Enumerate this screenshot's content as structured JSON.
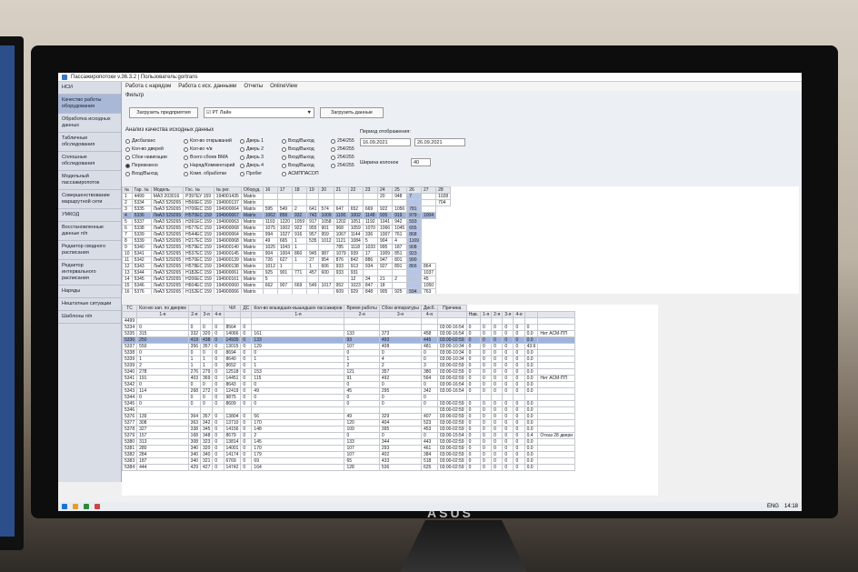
{
  "window": {
    "title": "Пассажиропотоки v.36.3.2 | Пользователь:gortrans"
  },
  "sidebar": {
    "items": [
      {
        "label": "НСИ"
      },
      {
        "label": "Качество работы оборудования"
      },
      {
        "label": "Обработка исходных данных"
      },
      {
        "label": "Табличные обследования"
      },
      {
        "label": "Сплошные обследования"
      },
      {
        "label": "Модельный пассажиропоток"
      },
      {
        "label": "Совершенствование маршрутной сети"
      },
      {
        "label": "УМКОД"
      },
      {
        "label": "Восстановленные данные п/п"
      },
      {
        "label": "Редактор сводного расписания"
      },
      {
        "label": "Редактор интервального расписания"
      },
      {
        "label": "Наряды"
      },
      {
        "label": "Нештатные ситуации"
      },
      {
        "label": "Шаблоны п/п"
      }
    ]
  },
  "menu": {
    "items": [
      "Работа с нарядом",
      "Работа с исх. данными",
      "Отчеты",
      "OnlineView"
    ]
  },
  "filter": {
    "label": "Фильтр",
    "load_enterprises": "Загрузить предприятия",
    "enterprise_value": "РТ Лайн",
    "load_data": "Загрузить данные",
    "analysis_label": "Анализ качества исходных данных",
    "radios": [
      [
        "Дисбаланс",
        "Кол-во открываний",
        "Дверь 1",
        "Вход/Выход",
        "254/255"
      ],
      [
        "Кол-во дверей",
        "Кол-во ч/в",
        "Дверь 2",
        "Вход/Выход",
        "254/255"
      ],
      [
        "Сбои навигации",
        "Всего сбоев ВМА",
        "Дверь 3",
        "Вход/Выход",
        "254/255"
      ],
      [
        "Перевезено",
        "Наряд/Комментарий",
        "Дверь 4",
        "Вход/Выход",
        "254/255"
      ],
      [
        "Вход/Выход",
        "Комп. обработки",
        "Пробег",
        "АСМППАСОП",
        ""
      ]
    ],
    "period_label": "Период отображения:",
    "date_from": "16.09.2021",
    "date_to": "26.09.2021",
    "width_label": "Ширина колонок",
    "width_value": "40"
  },
  "grid1": {
    "headers": [
      "№",
      "Гар. №",
      "Модель",
      "Гос. №",
      "№ рег.",
      "Оборуд.",
      "16",
      "17",
      "18",
      "19",
      "20",
      "21",
      "22",
      "23",
      "24",
      "25",
      "26",
      "27",
      "28"
    ],
    "rows": [
      [
        "1",
        "4499",
        "МАЗ 203016",
        "Р397ЕУ 159",
        "194001435",
        "Matrix",
        "",
        "",
        "",
        "",
        "",
        "",
        "",
        "",
        "20",
        "948",
        "7",
        "",
        "1028"
      ],
      [
        "2",
        "5334",
        "ЛиАЗ 529265",
        "Н566ЕС 159",
        "194900137",
        "Matrix",
        "",
        "",
        "",
        "",
        "",
        "",
        "",
        "",
        "",
        "",
        "",
        "",
        "704"
      ],
      [
        "3",
        "5335",
        "ЛиАЗ 529265",
        "Н706ЕС 159",
        "194900064",
        "Matrix",
        "595",
        "549",
        "2",
        "641",
        "574",
        "647",
        "652",
        "669",
        "922",
        "1056",
        "781",
        ""
      ],
      [
        "4",
        "5336",
        "ЛиАЗ 529265",
        "Н570ЕС 159",
        "194900067",
        "Matrix",
        "1062",
        "858",
        "932",
        "742",
        "1009",
        "1100",
        "1002",
        "1148",
        "935",
        "919",
        "979",
        "1004"
      ],
      [
        "5",
        "5337",
        "ЛиАЗ 529265",
        "Н391ЕС 159",
        "194900063",
        "Matrix",
        "1193",
        "1220",
        "1059",
        "917",
        "1058",
        "1202",
        "1051",
        "1192",
        "1041",
        "942",
        "593"
      ],
      [
        "6",
        "5338",
        "ЛиАЗ 529265",
        "Н577ЕС 159",
        "194900068",
        "Matrix",
        "1075",
        "1002",
        "922",
        "955",
        "901",
        "968",
        "1059",
        "1070",
        "1066",
        "1045",
        "655"
      ],
      [
        "7",
        "5339",
        "ЛиАЗ 529265",
        "Н544ЕС 159",
        "194900064",
        "Matrix",
        "994",
        "1027",
        "916",
        "957",
        "959",
        "1067",
        "1144",
        "336",
        "1007",
        "761",
        "868"
      ],
      [
        "8",
        "5339",
        "ЛиАЗ 529265",
        "Н217ЕС 159",
        "194900068",
        "Matrix",
        "49",
        "665",
        "1",
        "535",
        "1012",
        "1121",
        "1084",
        "5",
        "904",
        "4",
        "1169"
      ],
      [
        "9",
        "5340",
        "ЛиАЗ 529265",
        "Н579ЕС 159",
        "194900140",
        "Matrix",
        "1025",
        "1043",
        "1",
        "",
        "",
        "785",
        "1118",
        "1033",
        "995",
        "187",
        "908"
      ],
      [
        "10",
        "5341",
        "ЛиАЗ 529265",
        "Н537ЕС 159",
        "194900145",
        "Matrix",
        "904",
        "1004",
        "860",
        "945",
        "987",
        "1079",
        "939",
        "17",
        "1009",
        "851",
        "923"
      ],
      [
        "11",
        "5342",
        "ЛиАЗ 529265",
        "Н570ЕС 159",
        "194900139",
        "Matrix",
        "726",
        "627",
        "1",
        "27",
        "954",
        "876",
        "842",
        "886",
        "947",
        "801",
        "990"
      ],
      [
        "12",
        "5343",
        "ЛиАЗ 529265",
        "Н578ЕС 159",
        "194900138",
        "Matrix",
        "1012",
        "1",
        "",
        "1",
        "606",
        "933",
        "913",
        "934",
        "927",
        "891",
        "866",
        "864"
      ],
      [
        "13",
        "5344",
        "ЛиАЗ 529265",
        "Н182ЕС 159",
        "194900061",
        "Matrix",
        "925",
        "901",
        "771",
        "457",
        "600",
        "933",
        "931",
        "",
        "",
        "",
        "",
        "1037"
      ],
      [
        "14",
        "5345",
        "ЛиАЗ 529265",
        "Н206ЕС 159",
        "194900161",
        "Matrix",
        "5",
        "",
        "",
        "",
        "",
        "",
        "12",
        "34",
        "21",
        "2",
        "",
        "45"
      ],
      [
        "15",
        "5346",
        "ЛиАЗ 529265",
        "Н604ЕС 159",
        "194900060",
        "Matrix",
        "662",
        "907",
        "669",
        "549",
        "1017",
        "952",
        "1023",
        "847",
        "18",
        "",
        "",
        "1050"
      ],
      [
        "16",
        "5376",
        "ЛиАЗ 529265",
        "Н152ЕС 159",
        "194900066",
        "Matrix",
        "",
        "",
        "",
        "",
        "",
        "609",
        "929",
        "848",
        "905",
        "925",
        "594",
        "763"
      ],
      [
        "17",
        "5377",
        "ЛиАЗ 529265",
        "Н201ЕС 159",
        "194900138",
        "Matrix",
        "928",
        "848",
        "815",
        "",
        "",
        "",
        "1007",
        "",
        "",
        "",
        "",
        "1085"
      ],
      [
        "18",
        "5378",
        "ЛиАЗ 529265",
        "Н211ЕС 159",
        "194900135",
        "Matrix",
        "1129",
        "1179",
        "832",
        "922",
        "1126",
        "1115",
        "1197",
        "1195",
        "1084",
        "845",
        "954",
        "1119"
      ]
    ]
  },
  "grid2": {
    "headers_top": [
      "ТС",
      "Кол-во зап. по дверям",
      "",
      "",
      "",
      "ЧИ",
      "ДС",
      "Кол-во вошедших-вышедших пассажиров",
      "Время работы",
      "Сбои аппаратуры",
      "Дисб.",
      "Причина"
    ],
    "headers_sub": [
      "",
      "1-я",
      "2-я",
      "3-я",
      "4-я",
      "",
      "",
      "1-я",
      "2-я",
      "3-я",
      "4-я",
      "",
      "Нав.",
      "1-я",
      "2-я",
      "3-я",
      "4-я",
      "",
      ""
    ],
    "rows": [
      [
        "4499",
        "",
        "",
        "",
        "",
        "",
        "",
        "",
        "",
        "",
        "",
        "",
        "",
        "",
        "",
        "",
        "",
        "",
        ""
      ],
      [
        "5334",
        "0",
        "0",
        "0",
        "0",
        "8564",
        "0",
        "",
        "",
        "",
        "",
        "03:00-16:54",
        "0",
        "0",
        "0",
        "0",
        "0",
        "0",
        ""
      ],
      [
        "5335",
        "315",
        "332",
        "320",
        "0",
        "14066",
        "0",
        "161",
        "133",
        "373",
        "458",
        "03:00-16:54",
        "0",
        "0",
        "0",
        "0",
        "0",
        "0.0",
        "Нет АСМ-ПП"
      ],
      [
        "5336",
        "250",
        "419",
        "438",
        "0",
        "14935",
        "0",
        "133",
        "93",
        "493",
        "445",
        "03:00-02:59",
        "0",
        "0",
        "0",
        "0",
        "0",
        "0.0",
        ""
      ],
      [
        "5337",
        "550",
        "356",
        "357",
        "0",
        "13015",
        "0",
        "129",
        "107",
        "408",
        "481",
        "03:00-10:34",
        "0",
        "0",
        "0",
        "0",
        "0",
        "43.6",
        ""
      ],
      [
        "5338",
        "0",
        "0",
        "0",
        "0",
        "8694",
        "0",
        "0",
        "0",
        "0",
        "0",
        "03:00-10:34",
        "0",
        "0",
        "0",
        "0",
        "0",
        "0.0",
        ""
      ],
      [
        "5339",
        "1",
        "1",
        "1",
        "0",
        "8640",
        "0",
        "1",
        "1",
        "4",
        "0",
        "03:00-10:34",
        "0",
        "0",
        "0",
        "0",
        "0",
        "0.0",
        ""
      ],
      [
        "5339",
        "2",
        "1",
        "1",
        "0",
        "8652",
        "0",
        "1",
        "2",
        "2",
        "3",
        "03:00-02:59",
        "0",
        "0",
        "0",
        "0",
        "0",
        "0.0",
        ""
      ],
      [
        "5340",
        "278",
        "276",
        "279",
        "0",
        "12518",
        "0",
        "153",
        "121",
        "357",
        "380",
        "03:00-02:59",
        "0",
        "0",
        "0",
        "0",
        "0",
        "0.0",
        ""
      ],
      [
        "5341",
        "191",
        "403",
        "369",
        "0",
        "14451",
        "0",
        "115",
        "91",
        "492",
        "564",
        "03:00-02:59",
        "0",
        "0",
        "0",
        "0",
        "0",
        "0.0",
        "Нет АСМ-ПП"
      ],
      [
        "5342",
        "0",
        "0",
        "0",
        "0",
        "8643",
        "0",
        "0",
        "0",
        "0",
        "0",
        "03:00-16:54",
        "0",
        "0",
        "0",
        "0",
        "0",
        "0.0",
        ""
      ],
      [
        "5343",
        "114",
        "268",
        "272",
        "0",
        "12419",
        "0",
        "49",
        "45",
        "295",
        "342",
        "03:00-16:54",
        "0",
        "0",
        "0",
        "0",
        "0",
        "0.0",
        ""
      ],
      [
        "5344",
        "0",
        "0",
        "0",
        "0",
        "9875",
        "0",
        "0",
        "0",
        "0",
        "0",
        "",
        "",
        "",
        "",
        "",
        "",
        "",
        ""
      ],
      [
        "5345",
        "0",
        "0",
        "0",
        "0",
        "8609",
        "0",
        "0",
        "0",
        "0",
        "0",
        "03:00-02:59",
        "0",
        "0",
        "0",
        "0",
        "0",
        "0.0",
        ""
      ],
      [
        "5346",
        "",
        "",
        "",
        "",
        "",
        "",
        "",
        "",
        "",
        "",
        "03:00-02:59",
        "0",
        "0",
        "0",
        "0",
        "0",
        "0.0",
        ""
      ],
      [
        "5376",
        "139",
        "364",
        "357",
        "0",
        "13804",
        "0",
        "56",
        "49",
        "329",
        "407",
        "03:00-02:59",
        "0",
        "0",
        "0",
        "0",
        "0",
        "0.0",
        ""
      ],
      [
        "5377",
        "308",
        "363",
        "342",
        "0",
        "13710",
        "0",
        "170",
        "120",
        "404",
        "523",
        "03:00-02:59",
        "0",
        "0",
        "0",
        "0",
        "0",
        "0.0",
        ""
      ],
      [
        "5378",
        "327",
        "338",
        "345",
        "0",
        "14156",
        "0",
        "148",
        "109",
        "395",
        "453",
        "03:00-02:59",
        "0",
        "0",
        "0",
        "0",
        "0",
        "0.0",
        ""
      ],
      [
        "5379",
        "157",
        "168",
        "348",
        "0",
        "8679",
        "0",
        "2",
        "0",
        "0",
        "0",
        "03:00-15:54",
        "0",
        "0",
        "0",
        "0",
        "0",
        "0.4",
        "Отказ 28 двери"
      ],
      [
        "5380",
        "313",
        "308",
        "323",
        "0",
        "13814",
        "0",
        "145",
        "133",
        "344",
        "443",
        "03:00-02:59",
        "0",
        "0",
        "0",
        "0",
        "0",
        "0.0",
        ""
      ],
      [
        "5381",
        "280",
        "340",
        "320",
        "0",
        "14001",
        "0",
        "170",
        "107",
        "293",
        "461",
        "03:00-02:59",
        "0",
        "0",
        "0",
        "0",
        "0",
        "0.0",
        ""
      ],
      [
        "5382",
        "284",
        "340",
        "340",
        "0",
        "14174",
        "0",
        "179",
        "107",
        "402",
        "384",
        "03:00-02:59",
        "0",
        "0",
        "0",
        "0",
        "0",
        "0.0",
        ""
      ],
      [
        "5383",
        "187",
        "340",
        "321",
        "0",
        "6769",
        "0",
        "69",
        "65",
        "433",
        "518",
        "03:00-02:59",
        "0",
        "0",
        "0",
        "0",
        "0",
        "0.0",
        ""
      ],
      [
        "5384",
        "444",
        "429",
        "427",
        "0",
        "14742",
        "0",
        "164",
        "128",
        "536",
        "625",
        "03:00-02:59",
        "0",
        "0",
        "0",
        "0",
        "0",
        "0.0",
        ""
      ]
    ]
  },
  "tray": {
    "lang": "ENG",
    "time": "14:18"
  },
  "brand": "ASUS"
}
